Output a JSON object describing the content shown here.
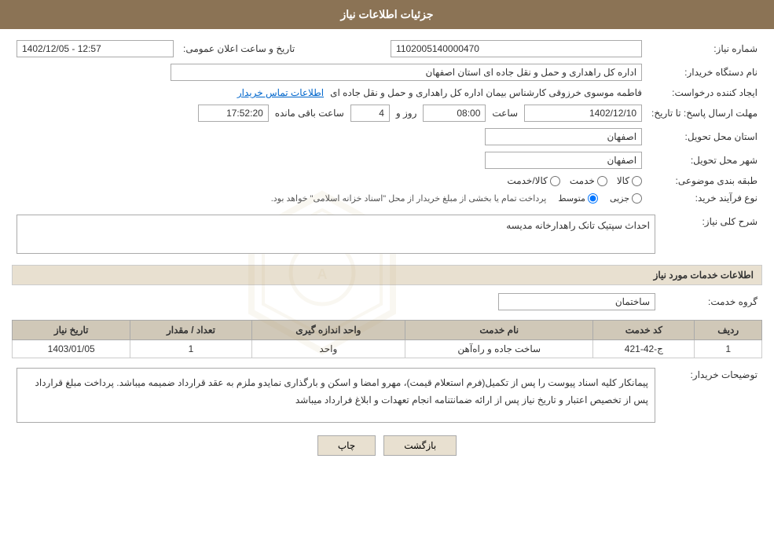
{
  "page": {
    "title": "جزئیات اطلاعات نیاز",
    "back_btn": "بازگشت",
    "print_btn": "چاپ"
  },
  "fields": {
    "need_number_label": "شماره نیاز:",
    "need_number_value": "1102005140000470",
    "buyer_org_label": "نام دستگاه خریدار:",
    "buyer_org_value": "اداره کل راهداری و حمل و نقل جاده ای استان اصفهان",
    "announce_date_label": "تاریخ و ساعت اعلان عمومی:",
    "announce_date_value": "1402/12/05 - 12:57",
    "creator_label": "ایجاد کننده درخواست:",
    "creator_value": "فاطمه موسوی خرزوقی کارشناس بیمان اداره کل راهداری و حمل و نقل جاده ای",
    "creator_link": "اطلاعات تماس خریدار",
    "deadline_label": "مهلت ارسال پاسخ: تا تاریخ:",
    "deadline_date": "1402/12/10",
    "deadline_time_label": "ساعت",
    "deadline_time": "08:00",
    "deadline_days_label": "روز و",
    "deadline_days": "4",
    "deadline_remaining_label": "ساعت باقی مانده",
    "deadline_remaining": "17:52:20",
    "province_label": "استان محل تحویل:",
    "province_value": "اصفهان",
    "city_label": "شهر محل تحویل:",
    "city_value": "اصفهان",
    "category_label": "طبقه بندی موضوعی:",
    "category_goods": "کالا",
    "category_service": "خدمت",
    "category_goods_service": "کالا/خدمت",
    "purchase_type_label": "نوع فرآیند خرید:",
    "purchase_partial": "جزیی",
    "purchase_medium": "متوسط",
    "purchase_description": "پرداخت تمام یا بخشی از مبلغ خریدار از محل \"اسناد خزانه اسلامی\" خواهد بود.",
    "need_description_label": "شرح کلی نیاز:",
    "need_description_value": "احداث سپتیک تانک راهدارخانه مدیسه",
    "services_section_title": "اطلاعات خدمات مورد نیاز",
    "service_group_label": "گروه خدمت:",
    "service_group_value": "ساختمان",
    "table_headers": {
      "row_num": "ردیف",
      "service_code": "کد خدمت",
      "service_name": "نام خدمت",
      "unit": "واحد اندازه گیری",
      "quantity": "تعداد / مقدار",
      "need_date": "تاریخ نیاز"
    },
    "table_rows": [
      {
        "row": "1",
        "code": "ج-42-421",
        "name": "ساخت جاده و راه‌آهن",
        "unit": "واحد",
        "quantity": "1",
        "date": "1403/01/05"
      }
    ],
    "buyer_notes_label": "توضیحات خریدار:",
    "buyer_notes_value": "پیمانکار کلیه اسناد پیوست را پس از تکمیل(فرم استعلام قیمت)، مهرو امضا و اسکن و بارگذاری نمایدو ملزم به عقد قرارداد ضمیمه میباشد. پرداخت مبلغ قرارداد پس از تخصیص اعتبار و تاریخ نیاز پس از ارائه ضمانتنامه انجام تعهدات و ابلاغ فرارداد میباشد"
  }
}
